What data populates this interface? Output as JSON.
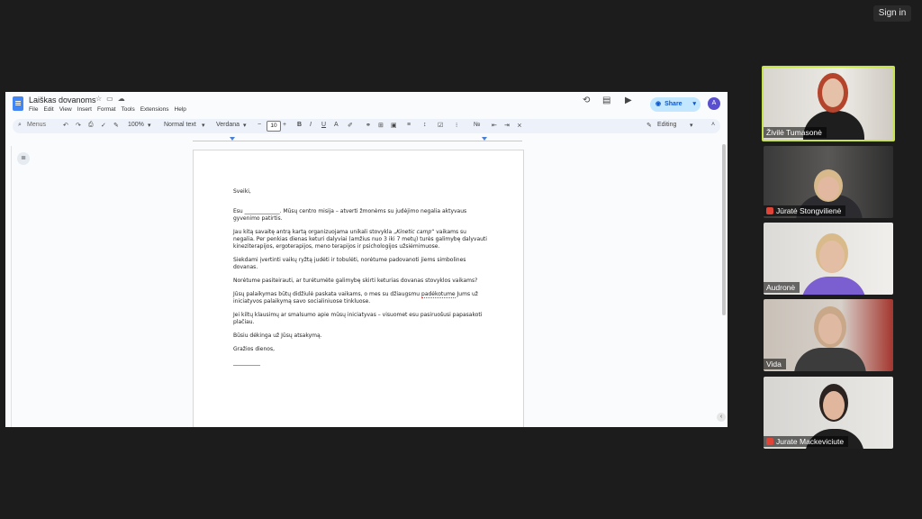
{
  "meeting": {
    "signin_label": "Sign in"
  },
  "doc": {
    "title": "Laiškas dovanoms",
    "menu": [
      "File",
      "Edit",
      "View",
      "Insert",
      "Format",
      "Tools",
      "Extensions",
      "Help"
    ],
    "share_label": "Share",
    "avatar_initial": "A",
    "toolbar": {
      "menus_placeholder": "Menus",
      "zoom": "100%",
      "style": "Normal text",
      "font": "Verdana",
      "font_size": "10",
      "mode": "Editing"
    },
    "body": {
      "greeting": "Sveiki,",
      "p1": "Esu _____________. Mūsų centro misija – atverti žmonėms su judėjimo negalia aktyvaus gyvenimo patirtis.",
      "p2_pre": "Jau kitą savaitę antrą kartą organizuojama unikali stovykla „",
      "p2_em": "Kinetic camp",
      "p2_post": "“ vaikams su negalia. Per penkias dienas keturi dalyviai (amžius nuo 3 iki 7 metų) turės galimybę dalyvauti kineziterapijos, ergoterapijos, meno terapijos ir psichologijos užsiėmimuose.",
      "p3": "Siekdami įvertinti vaikų ryžtą judėti ir tobulėti, norėtume padovanoti jiems simbolines dovanas.",
      "p4": "Norėtume pasiteirauti, ar turėtumėte galimybę skirti keturias dovanas stovyklos vaikams?",
      "p5_pre": "Jūsų palaikymas būtų didžiulė paskata vaikams, o mes su džiaugsmu ",
      "p5_word": "padėkotume",
      "p5_post": " Jums už iniciatyvos palaikymą savo socialiniuose tinkluose.",
      "p6": "Jei kiltų klausimų ar smalsumo apie mūsų iniciatyvas – visuomet esu pasiruošusi papasakoti plačiau.",
      "p7": "Būsiu dėkinga už Jūsų atsakymą.",
      "closing": "Gražios dienos,",
      "signature": "__________"
    }
  },
  "participants": [
    {
      "name": "Živilė Tumasonė",
      "muted": false,
      "active": true
    },
    {
      "name": "Jūratė Stongvilienė",
      "muted": true,
      "active": false
    },
    {
      "name": "Audronė",
      "muted": false,
      "active": false
    },
    {
      "name": "Vida",
      "muted": false,
      "active": false
    },
    {
      "name": "Jurate Mackeviciute",
      "muted": true,
      "active": false
    }
  ],
  "colors": {
    "background": "#1c1c1c",
    "active_speaker": "#c7e34a",
    "share_button": "#c2e7ff",
    "mute": "#e04436"
  }
}
